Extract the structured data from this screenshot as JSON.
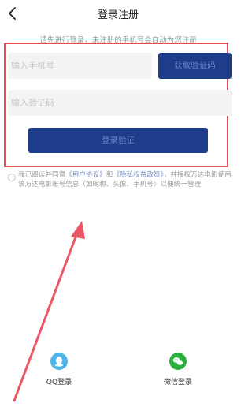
{
  "header": {
    "title": "登录注册",
    "back_icon": "chevron-left-icon"
  },
  "hint": "请先进行登录，未注册的手机号会自动为您注册",
  "form": {
    "phone_placeholder": "输入手机号",
    "get_code_label": "获取验证码",
    "code_placeholder": "输入验证码",
    "login_label": "登录验证"
  },
  "agreement": {
    "prefix": "我已阅读并同意",
    "user_agreement": "《用户协议》",
    "and": "和",
    "privacy_policy": "《隐私权益政策》",
    "suffix": "，并授权万达电影使用该万达电影账号信息（如昵称、头像、手机号）以便统一管理"
  },
  "social_login": {
    "qq_label": "QQ登录",
    "wechat_label": "微信登录",
    "qq_icon": "qq-icon",
    "wechat_icon": "wechat-icon"
  },
  "colors": {
    "primary": "#1d3c8a",
    "button_text": "#6b84c4",
    "highlight": "#e24a55",
    "qq": "#4fb6ec",
    "wechat": "#29b03d"
  }
}
